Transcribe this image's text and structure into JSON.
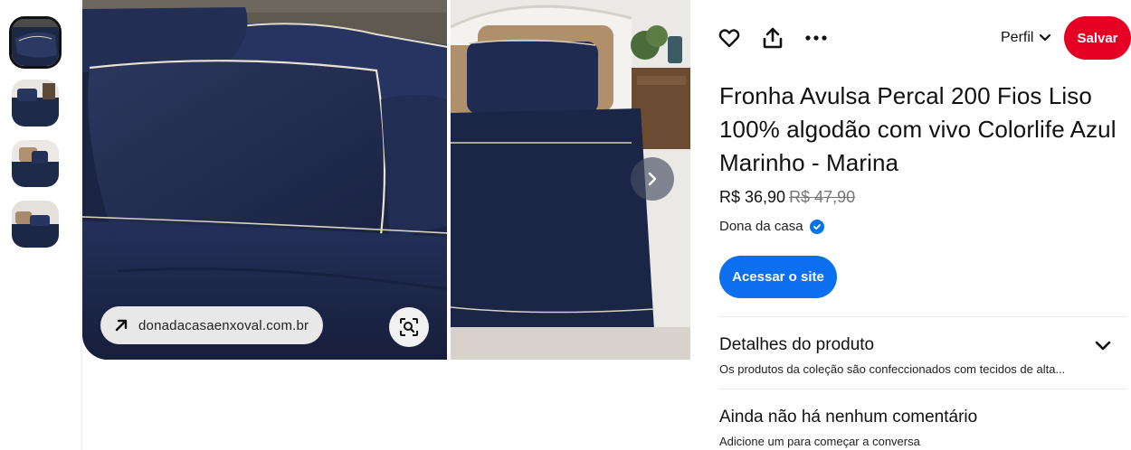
{
  "thumbnails": [
    {
      "name": "thumbnail-1",
      "selected": true
    },
    {
      "name": "thumbnail-2",
      "selected": false
    },
    {
      "name": "thumbnail-3",
      "selected": false
    },
    {
      "name": "thumbnail-4",
      "selected": false
    }
  ],
  "image": {
    "source_domain": "donadacasaenxoval.com.br"
  },
  "toolbar": {
    "like_icon": "heart-icon",
    "share_icon": "share-icon",
    "more_icon": "more-icon",
    "profile_label": "Perfil",
    "save_label": "Salvar",
    "save_color": "#e60023"
  },
  "product": {
    "title": "Fronha Avulsa Percal 200 Fios Liso 100% algodão com vivo Colorlife Azul Marinho - Marina",
    "price": "R$ 36,90",
    "old_price": "R$ 47,90",
    "seller": "Dona da casa",
    "visit_label": "Acessar o site",
    "visit_color": "#0b6ff0"
  },
  "details": {
    "title": "Detalhes do produto",
    "summary": "Os produtos da coleção são confeccionados com tecidos de alta..."
  },
  "comments": {
    "title": "Ainda não há nenhum comentário",
    "subtitle": "Adicione um para começar a conversa"
  }
}
